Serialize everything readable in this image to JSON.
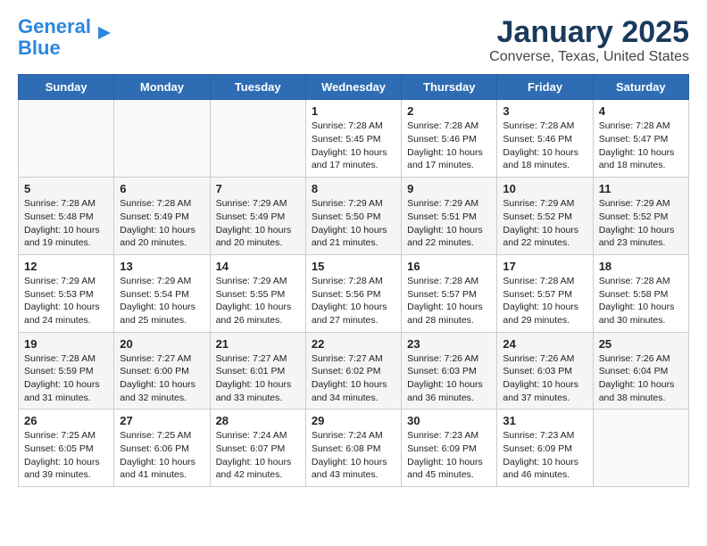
{
  "header": {
    "logo_line1": "General",
    "logo_line2": "Blue",
    "title": "January 2025",
    "subtitle": "Converse, Texas, United States"
  },
  "weekdays": [
    "Sunday",
    "Monday",
    "Tuesday",
    "Wednesday",
    "Thursday",
    "Friday",
    "Saturday"
  ],
  "weeks": [
    [
      {
        "day": "",
        "info": ""
      },
      {
        "day": "",
        "info": ""
      },
      {
        "day": "",
        "info": ""
      },
      {
        "day": "1",
        "info": "Sunrise: 7:28 AM\nSunset: 5:45 PM\nDaylight: 10 hours and 17 minutes."
      },
      {
        "day": "2",
        "info": "Sunrise: 7:28 AM\nSunset: 5:46 PM\nDaylight: 10 hours and 17 minutes."
      },
      {
        "day": "3",
        "info": "Sunrise: 7:28 AM\nSunset: 5:46 PM\nDaylight: 10 hours and 18 minutes."
      },
      {
        "day": "4",
        "info": "Sunrise: 7:28 AM\nSunset: 5:47 PM\nDaylight: 10 hours and 18 minutes."
      }
    ],
    [
      {
        "day": "5",
        "info": "Sunrise: 7:28 AM\nSunset: 5:48 PM\nDaylight: 10 hours and 19 minutes."
      },
      {
        "day": "6",
        "info": "Sunrise: 7:28 AM\nSunset: 5:49 PM\nDaylight: 10 hours and 20 minutes."
      },
      {
        "day": "7",
        "info": "Sunrise: 7:29 AM\nSunset: 5:49 PM\nDaylight: 10 hours and 20 minutes."
      },
      {
        "day": "8",
        "info": "Sunrise: 7:29 AM\nSunset: 5:50 PM\nDaylight: 10 hours and 21 minutes."
      },
      {
        "day": "9",
        "info": "Sunrise: 7:29 AM\nSunset: 5:51 PM\nDaylight: 10 hours and 22 minutes."
      },
      {
        "day": "10",
        "info": "Sunrise: 7:29 AM\nSunset: 5:52 PM\nDaylight: 10 hours and 22 minutes."
      },
      {
        "day": "11",
        "info": "Sunrise: 7:29 AM\nSunset: 5:52 PM\nDaylight: 10 hours and 23 minutes."
      }
    ],
    [
      {
        "day": "12",
        "info": "Sunrise: 7:29 AM\nSunset: 5:53 PM\nDaylight: 10 hours and 24 minutes."
      },
      {
        "day": "13",
        "info": "Sunrise: 7:29 AM\nSunset: 5:54 PM\nDaylight: 10 hours and 25 minutes."
      },
      {
        "day": "14",
        "info": "Sunrise: 7:29 AM\nSunset: 5:55 PM\nDaylight: 10 hours and 26 minutes."
      },
      {
        "day": "15",
        "info": "Sunrise: 7:28 AM\nSunset: 5:56 PM\nDaylight: 10 hours and 27 minutes."
      },
      {
        "day": "16",
        "info": "Sunrise: 7:28 AM\nSunset: 5:57 PM\nDaylight: 10 hours and 28 minutes."
      },
      {
        "day": "17",
        "info": "Sunrise: 7:28 AM\nSunset: 5:57 PM\nDaylight: 10 hours and 29 minutes."
      },
      {
        "day": "18",
        "info": "Sunrise: 7:28 AM\nSunset: 5:58 PM\nDaylight: 10 hours and 30 minutes."
      }
    ],
    [
      {
        "day": "19",
        "info": "Sunrise: 7:28 AM\nSunset: 5:59 PM\nDaylight: 10 hours and 31 minutes."
      },
      {
        "day": "20",
        "info": "Sunrise: 7:27 AM\nSunset: 6:00 PM\nDaylight: 10 hours and 32 minutes."
      },
      {
        "day": "21",
        "info": "Sunrise: 7:27 AM\nSunset: 6:01 PM\nDaylight: 10 hours and 33 minutes."
      },
      {
        "day": "22",
        "info": "Sunrise: 7:27 AM\nSunset: 6:02 PM\nDaylight: 10 hours and 34 minutes."
      },
      {
        "day": "23",
        "info": "Sunrise: 7:26 AM\nSunset: 6:03 PM\nDaylight: 10 hours and 36 minutes."
      },
      {
        "day": "24",
        "info": "Sunrise: 7:26 AM\nSunset: 6:03 PM\nDaylight: 10 hours and 37 minutes."
      },
      {
        "day": "25",
        "info": "Sunrise: 7:26 AM\nSunset: 6:04 PM\nDaylight: 10 hours and 38 minutes."
      }
    ],
    [
      {
        "day": "26",
        "info": "Sunrise: 7:25 AM\nSunset: 6:05 PM\nDaylight: 10 hours and 39 minutes."
      },
      {
        "day": "27",
        "info": "Sunrise: 7:25 AM\nSunset: 6:06 PM\nDaylight: 10 hours and 41 minutes."
      },
      {
        "day": "28",
        "info": "Sunrise: 7:24 AM\nSunset: 6:07 PM\nDaylight: 10 hours and 42 minutes."
      },
      {
        "day": "29",
        "info": "Sunrise: 7:24 AM\nSunset: 6:08 PM\nDaylight: 10 hours and 43 minutes."
      },
      {
        "day": "30",
        "info": "Sunrise: 7:23 AM\nSunset: 6:09 PM\nDaylight: 10 hours and 45 minutes."
      },
      {
        "day": "31",
        "info": "Sunrise: 7:23 AM\nSunset: 6:09 PM\nDaylight: 10 hours and 46 minutes."
      },
      {
        "day": "",
        "info": ""
      }
    ]
  ]
}
